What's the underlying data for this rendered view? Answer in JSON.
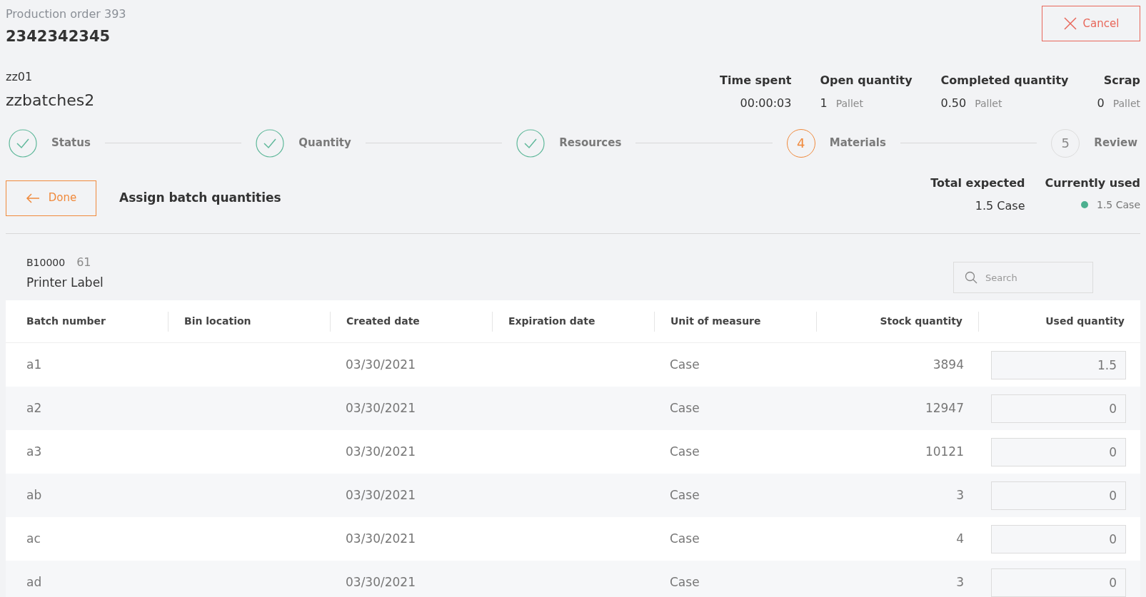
{
  "header": {
    "subtitle": "Production order 393",
    "title": "2342342345",
    "cancel": "Cancel"
  },
  "item": {
    "code": "zz01",
    "name": "zzbatches2"
  },
  "stats": [
    {
      "label": "Time spent",
      "value": "00:00:03"
    },
    {
      "label": "Open quantity",
      "value": "1",
      "unit": "Pallet"
    },
    {
      "label": "Completed quantity",
      "value": "0.50",
      "unit": "Pallet"
    },
    {
      "label": "Scrap",
      "value": "0",
      "unit": "Pallet"
    }
  ],
  "steps": [
    {
      "kind": "done",
      "label": "Status"
    },
    {
      "kind": "done",
      "label": "Quantity"
    },
    {
      "kind": "done",
      "label": "Resources"
    },
    {
      "kind": "current",
      "number": "4",
      "label": "Materials"
    },
    {
      "kind": "pending",
      "number": "5",
      "label": "Review"
    }
  ],
  "toolbar": {
    "back": "Done",
    "title": "Assign batch quantities",
    "total_label": "Total expected",
    "total_value": "1.5 Case",
    "used_label": "Currently used",
    "used_value": "1.5 Case",
    "used_ok": true
  },
  "material": {
    "code": "B10000",
    "count": "61",
    "name": "Printer Label",
    "search_placeholder": "Search"
  },
  "table": {
    "columns": [
      "Batch number",
      "Bin location",
      "Created date",
      "Expiration date",
      "Unit of measure",
      "Stock quantity",
      "Used quantity"
    ],
    "rows": [
      {
        "batch": "a1",
        "created": "03/30/2021",
        "uom": "Case",
        "stock": "3894",
        "used": "1.5"
      },
      {
        "batch": "a2",
        "created": "03/30/2021",
        "uom": "Case",
        "stock": "12947",
        "used": "0"
      },
      {
        "batch": "a3",
        "created": "03/30/2021",
        "uom": "Case",
        "stock": "10121",
        "used": "0"
      },
      {
        "batch": "ab",
        "created": "03/30/2021",
        "uom": "Case",
        "stock": "3",
        "used": "0"
      },
      {
        "batch": "ac",
        "created": "03/30/2021",
        "uom": "Case",
        "stock": "4",
        "used": "0"
      },
      {
        "batch": "ad",
        "created": "03/30/2021",
        "uom": "Case",
        "stock": "3",
        "used": "0"
      }
    ]
  }
}
